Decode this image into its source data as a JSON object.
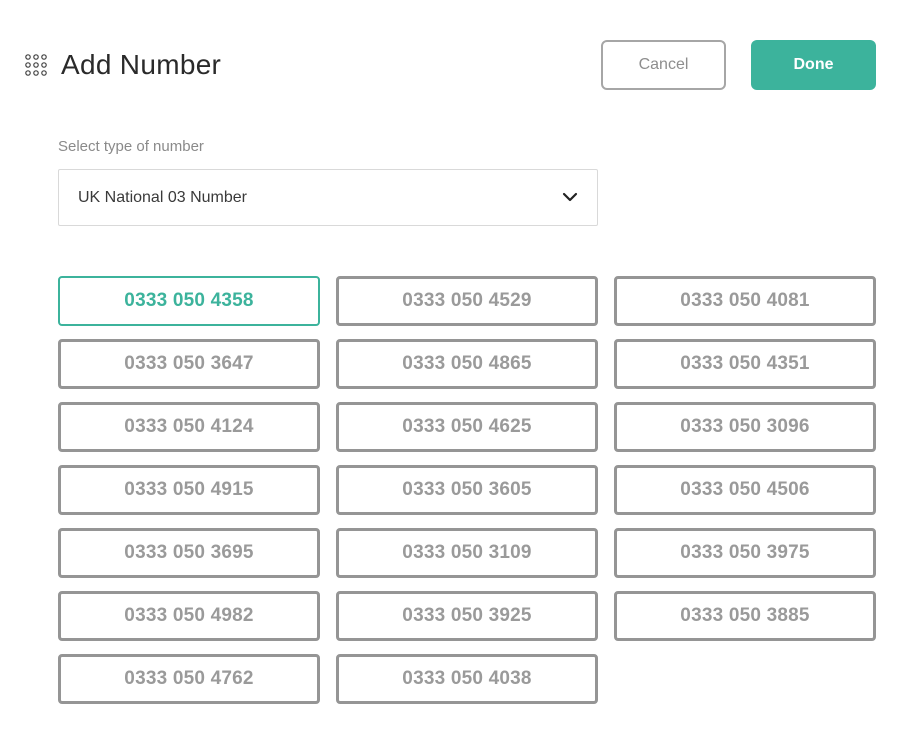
{
  "header": {
    "icon": "dialpad-icon",
    "title": "Add Number",
    "cancel_label": "Cancel",
    "done_label": "Done"
  },
  "number_type": {
    "label": "Select type of number",
    "selected": "UK National 03 Number"
  },
  "colors": {
    "accent": "#3cb39c",
    "border": "#959595",
    "muted_text": "#9a9a9a"
  },
  "numbers": [
    {
      "value": "0333 050 4358",
      "selected": true
    },
    {
      "value": "0333 050 4529",
      "selected": false
    },
    {
      "value": "0333 050 4081",
      "selected": false
    },
    {
      "value": "0333 050 3647",
      "selected": false
    },
    {
      "value": "0333 050 4865",
      "selected": false
    },
    {
      "value": "0333 050 4351",
      "selected": false
    },
    {
      "value": "0333 050 4124",
      "selected": false
    },
    {
      "value": "0333 050 4625",
      "selected": false
    },
    {
      "value": "0333 050 3096",
      "selected": false
    },
    {
      "value": "0333 050 4915",
      "selected": false
    },
    {
      "value": "0333 050 3605",
      "selected": false
    },
    {
      "value": "0333 050 4506",
      "selected": false
    },
    {
      "value": "0333 050 3695",
      "selected": false
    },
    {
      "value": "0333 050 3109",
      "selected": false
    },
    {
      "value": "0333 050 3975",
      "selected": false
    },
    {
      "value": "0333 050 4982",
      "selected": false
    },
    {
      "value": "0333 050 3925",
      "selected": false
    },
    {
      "value": "0333 050 3885",
      "selected": false
    },
    {
      "value": "0333 050 4762",
      "selected": false
    },
    {
      "value": "0333 050 4038",
      "selected": false
    }
  ]
}
